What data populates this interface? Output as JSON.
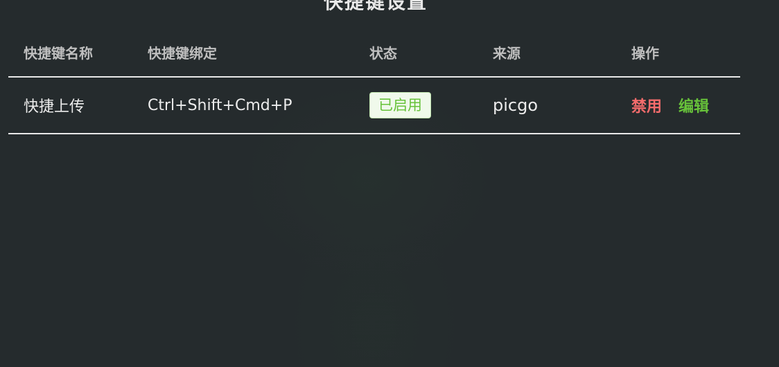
{
  "page": {
    "title": "快捷键设置"
  },
  "table": {
    "headers": [
      "快捷键名称",
      "快捷键绑定",
      "状态",
      "来源",
      "操作"
    ],
    "rows": [
      {
        "name": "快捷上传",
        "binding": "Ctrl+Shift+Cmd+P",
        "status": "已启用",
        "source": "picgo",
        "actions": {
          "disable": "禁用",
          "edit": "编辑"
        }
      }
    ]
  },
  "colors": {
    "background": "#252b2d",
    "enabled_badge_text": "#67c23a",
    "enabled_badge_bg": "#f0f9eb",
    "disable_action": "#f56c6c",
    "edit_action": "#67c23a"
  }
}
